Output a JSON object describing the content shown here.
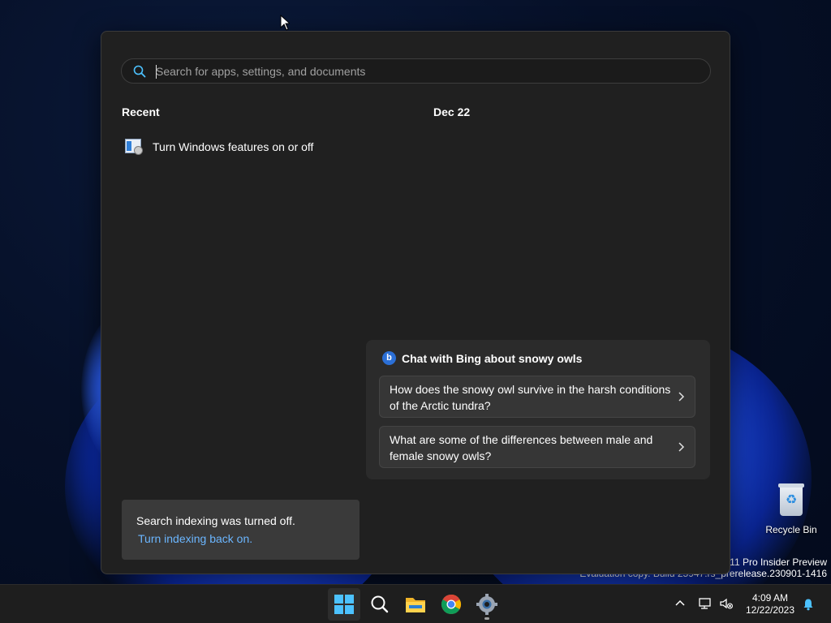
{
  "search": {
    "placeholder": "Search for apps, settings, and documents"
  },
  "recent": {
    "title": "Recent",
    "items": [
      {
        "label": "Turn Windows features on or off",
        "icon": "windows-features-icon"
      }
    ]
  },
  "date_section": {
    "title": "Dec 22"
  },
  "bing": {
    "heading": "Chat with Bing about snowy owls",
    "questions": [
      {
        "text": "How does the snowy owl survive in the harsh conditions of the Arctic tundra?"
      },
      {
        "text": "What are some of the differences between male and female snowy owls?"
      }
    ]
  },
  "notice": {
    "message": "Search indexing was turned off.",
    "link": "Turn indexing back on."
  },
  "desktop": {
    "recycle_bin_label": "Recycle Bin",
    "watermark_line1": "s 11 Pro Insider Preview",
    "watermark_line2": "Evaluation copy. Build 25947.rs_prerelease.230901-1416"
  },
  "taskbar": {
    "apps": [
      "start-icon",
      "search-icon",
      "file-explorer-icon",
      "chrome-icon",
      "settings-icon"
    ],
    "time": "4:09 AM",
    "date": "12/22/2023"
  },
  "colors": {
    "panel_bg": "#202020",
    "accent_link": "#6bb6ff",
    "taskbar_bg": "#1e1e1e",
    "start_blue": "#4cc2ff"
  }
}
